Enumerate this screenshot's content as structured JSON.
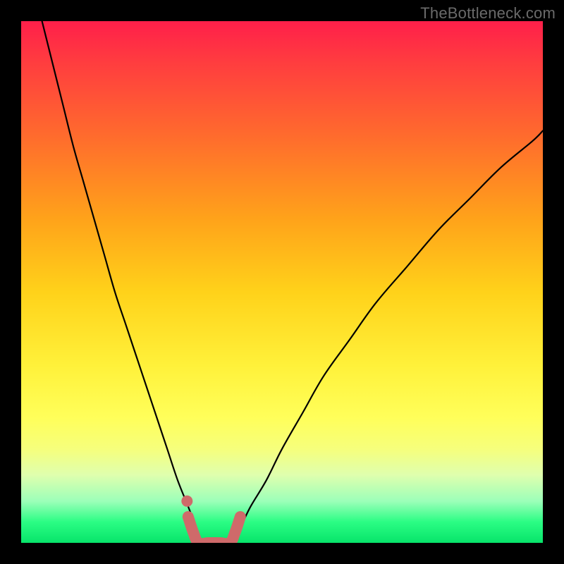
{
  "watermark": "TheBottleneck.com",
  "chart_data": {
    "type": "line",
    "title": "",
    "xlabel": "",
    "ylabel": "",
    "xlim": [
      0,
      100
    ],
    "ylim": [
      0,
      100
    ],
    "background_gradient": {
      "top": "#ff1f4a",
      "bottom": "#07e46a",
      "meaning": "red = high bottleneck, green = low bottleneck"
    },
    "series": [
      {
        "name": "left-curve",
        "x": [
          4,
          6,
          8,
          10,
          12,
          14,
          16,
          18,
          20,
          22,
          24,
          26,
          28,
          30,
          32,
          33.5,
          34.5
        ],
        "y": [
          100,
          92,
          84,
          76,
          69,
          62,
          55,
          48,
          42,
          36,
          30,
          24,
          18,
          12,
          7,
          3,
          0
        ]
      },
      {
        "name": "right-curve",
        "x": [
          40,
          42,
          44,
          47,
          50,
          54,
          58,
          63,
          68,
          74,
          80,
          86,
          92,
          98,
          100
        ],
        "y": [
          0,
          3,
          7,
          12,
          18,
          25,
          32,
          39,
          46,
          53,
          60,
          66,
          72,
          77,
          79
        ]
      },
      {
        "name": "valley-segment",
        "stroke": "#cf6a6a",
        "stroke_width": 16,
        "x": [
          32,
          33,
          34,
          36,
          38,
          40,
          41,
          42
        ],
        "y": [
          5,
          2,
          0,
          0,
          0,
          0,
          2,
          5
        ]
      },
      {
        "name": "marker-dot",
        "type": "scatter",
        "stroke": "#cf6a6a",
        "x": [
          31.8
        ],
        "y": [
          8
        ]
      }
    ]
  }
}
